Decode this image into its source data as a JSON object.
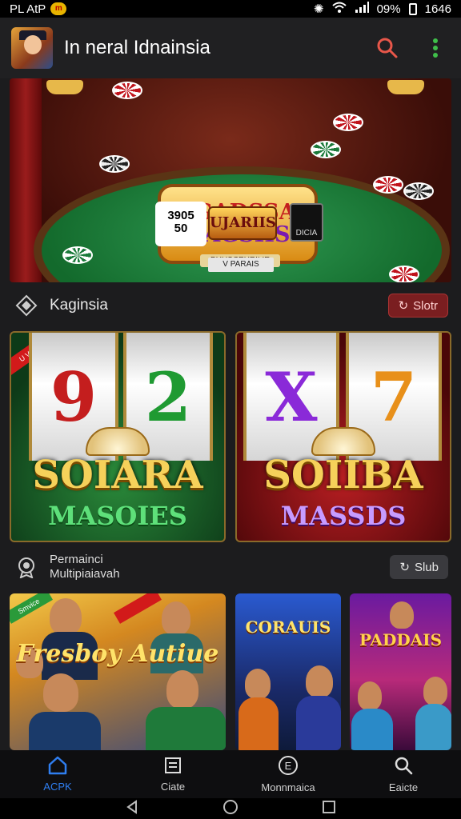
{
  "status_bar": {
    "left_text": "PL AtP",
    "notification_badge": "m",
    "battery_percent": "09%",
    "time": "1646"
  },
  "app_bar": {
    "title": "In neral Idnainsia"
  },
  "hero": {
    "sign_line1": "INGADSSAL",
    "sign_line2": "BAGSIIS",
    "sign_sub": "BUUSCEHRILIE",
    "card_text1": "3905",
    "card_text2": "50",
    "plaque_text": "UJARIIS",
    "tile_text": "DICIA",
    "bottom_plaque": "V PARAIS"
  },
  "section1": {
    "title": "Kaginsia",
    "button_label": "Slotr"
  },
  "slot_tiles": [
    {
      "reel1": "9",
      "reel2": "2",
      "ribbon": "U VINICS",
      "title1": "SOIARA",
      "title2": "MASOIES"
    },
    {
      "reel1": "X",
      "reel2": "7",
      "title1": "SOIIBA",
      "title2": "MASSDS"
    }
  ],
  "section2": {
    "title_line1": "Permainci",
    "title_line2": "Multipiaiavah",
    "button_label": "Slub"
  },
  "game_tiles": [
    {
      "title": "Fresboy Autiue",
      "tag": "Smvice"
    },
    {
      "title": "CORAUIS"
    },
    {
      "title": "PADDAIS"
    }
  ],
  "bottom_nav": [
    {
      "label": "ACPK",
      "icon": "home-icon"
    },
    {
      "label": "Ciate",
      "icon": "list-icon"
    },
    {
      "label": "Monnmaica",
      "icon": "e-circle-icon"
    },
    {
      "label": "Eaicte",
      "icon": "search-icon"
    }
  ],
  "colors": {
    "accent_active": "#2f7ef0",
    "search_icon": "#e8574a",
    "menu_dots": "#3fbf4a"
  }
}
